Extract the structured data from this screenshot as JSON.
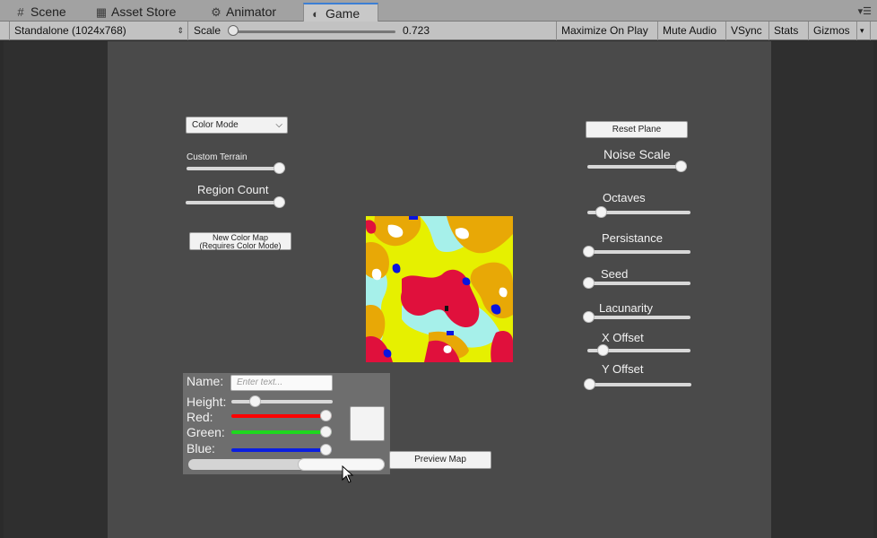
{
  "tabs": [
    {
      "label": "Scene",
      "icon": "grid-icon"
    },
    {
      "label": "Asset Store",
      "icon": "store-icon"
    },
    {
      "label": "Animator",
      "icon": "animator-icon"
    },
    {
      "label": "Game",
      "icon": "game-icon",
      "active": true
    }
  ],
  "toolbar": {
    "resolution": "Standalone (1024x768)",
    "scale_label": "Scale",
    "scale_value": "0.723",
    "scale_fraction": 0.0,
    "maximize": "Maximize On Play",
    "mute": "Mute Audio",
    "vsync": "VSync",
    "stats": "Stats",
    "gizmos": "Gizmos"
  },
  "left_controls": {
    "color_mode": "Color Mode",
    "custom_terrain": "Custom Terrain",
    "custom_terrain_value": 1.0,
    "region_count": "Region Count",
    "region_count_value": 1.0,
    "new_color_map_line1": "New Color Map",
    "new_color_map_line2": "(Requires Color Mode)"
  },
  "right_controls": {
    "reset_plane": "Reset Plane",
    "noise_scale": "Noise Scale",
    "noise_scale_value": 1.0,
    "octaves": "Octaves",
    "octaves_value": 0.13,
    "persistance": "Persistance",
    "persistance_value": 0.0,
    "seed": "Seed",
    "seed_value": 0.0,
    "lacunarity": "Lacunarity",
    "lacunarity_value": 0.0,
    "x_offset": "X Offset",
    "x_offset_value": 0.15,
    "y_offset": "Y Offset",
    "y_offset_value": 0.0
  },
  "region_panel": {
    "name_label": "Name:",
    "name_placeholder": "Enter text...",
    "height_label": "Height:",
    "height_value": 0.24,
    "red_label": "Red:",
    "red_value": 1.0,
    "green_label": "Green:",
    "green_value": 1.0,
    "blue_label": "Blue:",
    "blue_value": 1.0,
    "preview_map": "Preview Map"
  },
  "colors": {
    "red": "#e0103c",
    "orange": "#e8a806",
    "yellow": "#e6f000",
    "cyan": "#a6f0ea",
    "blue": "#0a14e0",
    "white": "#ffffff"
  }
}
